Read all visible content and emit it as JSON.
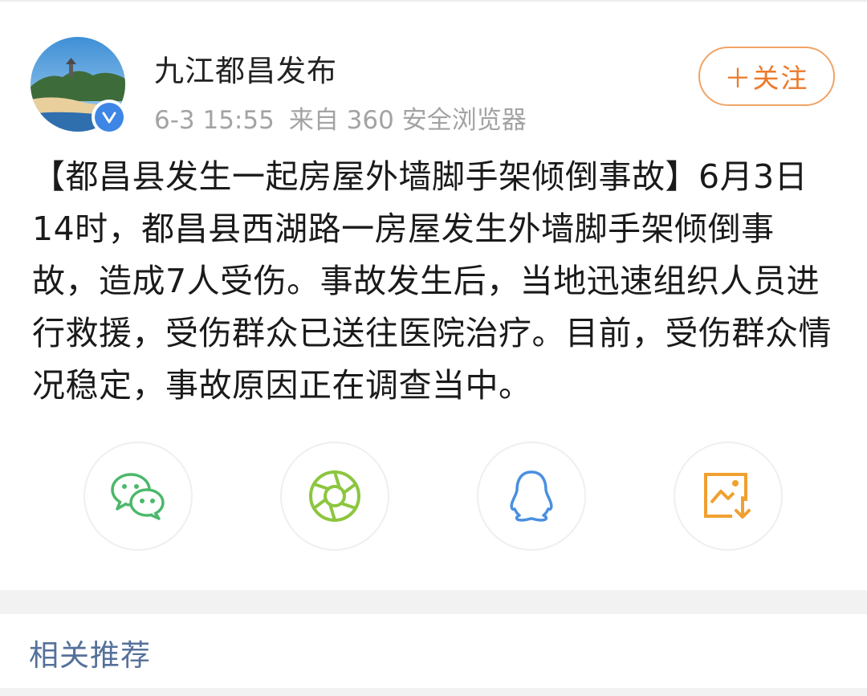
{
  "account": {
    "name": "九江都昌发布",
    "verified_icon": "verified-check-icon",
    "date_time": "6-3 15:55",
    "source": "来自 360 安全浏览器"
  },
  "follow_button": {
    "label": "＋关注",
    "color": "#ec7a2a"
  },
  "post": {
    "text": "【都昌县发生一起房屋外墙脚手架倾倒事故】6月3日14时，都昌县西湖路一房屋发生外墙脚手架倾倒事故，造成7人受伤。事故发生后，当地迅速组织人员进行救援，受伤群众已送往医院治疗。目前，受伤群众情况稳定，事故原因正在调查当中。"
  },
  "share_buttons": [
    {
      "icon": "wechat-icon",
      "color": "#4cb86b"
    },
    {
      "icon": "moments-aperture-icon",
      "color": "#8cc63f"
    },
    {
      "icon": "qq-penguin-icon",
      "color": "#4a8fe0"
    },
    {
      "icon": "save-image-icon",
      "color": "#f0a030"
    }
  ],
  "related": {
    "title": "相关推荐"
  },
  "colors": {
    "accent_blue": "#3d86e6",
    "link_text": "#55719a",
    "meta_gray": "#a3a3a3"
  }
}
